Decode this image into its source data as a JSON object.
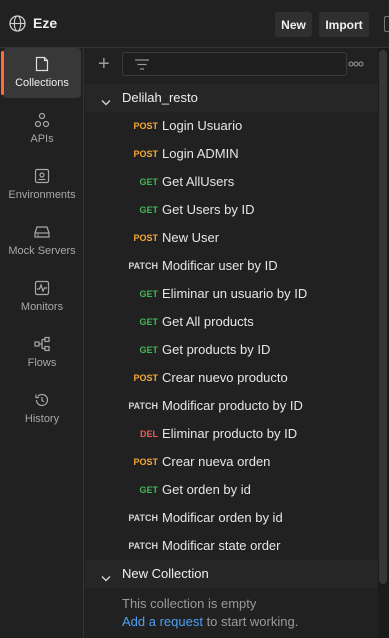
{
  "header": {
    "workspace_name": "Eze",
    "new_label": "New",
    "import_label": "Import"
  },
  "sidebar": {
    "items": [
      {
        "label": "Collections",
        "icon": "collections-icon",
        "active": true
      },
      {
        "label": "APIs",
        "icon": "apis-icon"
      },
      {
        "label": "Environments",
        "icon": "environments-icon"
      },
      {
        "label": "Mock Servers",
        "icon": "mock-servers-icon"
      },
      {
        "label": "Monitors",
        "icon": "monitors-icon"
      },
      {
        "label": "Flows",
        "icon": "flows-icon"
      },
      {
        "label": "History",
        "icon": "history-icon"
      }
    ]
  },
  "colors": {
    "post": "#f2a83a",
    "get": "#3fb950",
    "patch": "#d4d4d4",
    "delete": "#f05a4f",
    "accent": "#ff6c37",
    "link": "#4d9ff5"
  },
  "collections": [
    {
      "name": "Delilah_resto",
      "requests": [
        {
          "method": "POST",
          "name": "Login Usuario"
        },
        {
          "method": "POST",
          "name": "Login ADMIN"
        },
        {
          "method": "GET",
          "name": "Get AllUsers"
        },
        {
          "method": "GET",
          "name": "Get Users by ID"
        },
        {
          "method": "POST",
          "name": "New User"
        },
        {
          "method": "PATCH",
          "name": "Modificar user by ID"
        },
        {
          "method": "GET",
          "name": "Eliminar un usuario by ID"
        },
        {
          "method": "GET",
          "name": "Get All products"
        },
        {
          "method": "GET",
          "name": "Get products by ID"
        },
        {
          "method": "POST",
          "name": "Crear nuevo producto"
        },
        {
          "method": "PATCH",
          "name": "Modificar producto by ID"
        },
        {
          "method": "DEL",
          "name": "Eliminar producto by ID"
        },
        {
          "method": "POST",
          "name": "Crear nueva orden"
        },
        {
          "method": "GET",
          "name": "Get orden by id"
        },
        {
          "method": "PATCH",
          "name": "Modificar orden by id"
        },
        {
          "method": "PATCH",
          "name": "Modificar state order"
        }
      ]
    },
    {
      "name": "New Collection",
      "empty_message": "This collection is empty",
      "add_request_link": "Add a request",
      "add_request_suffix": " to start working."
    }
  ]
}
